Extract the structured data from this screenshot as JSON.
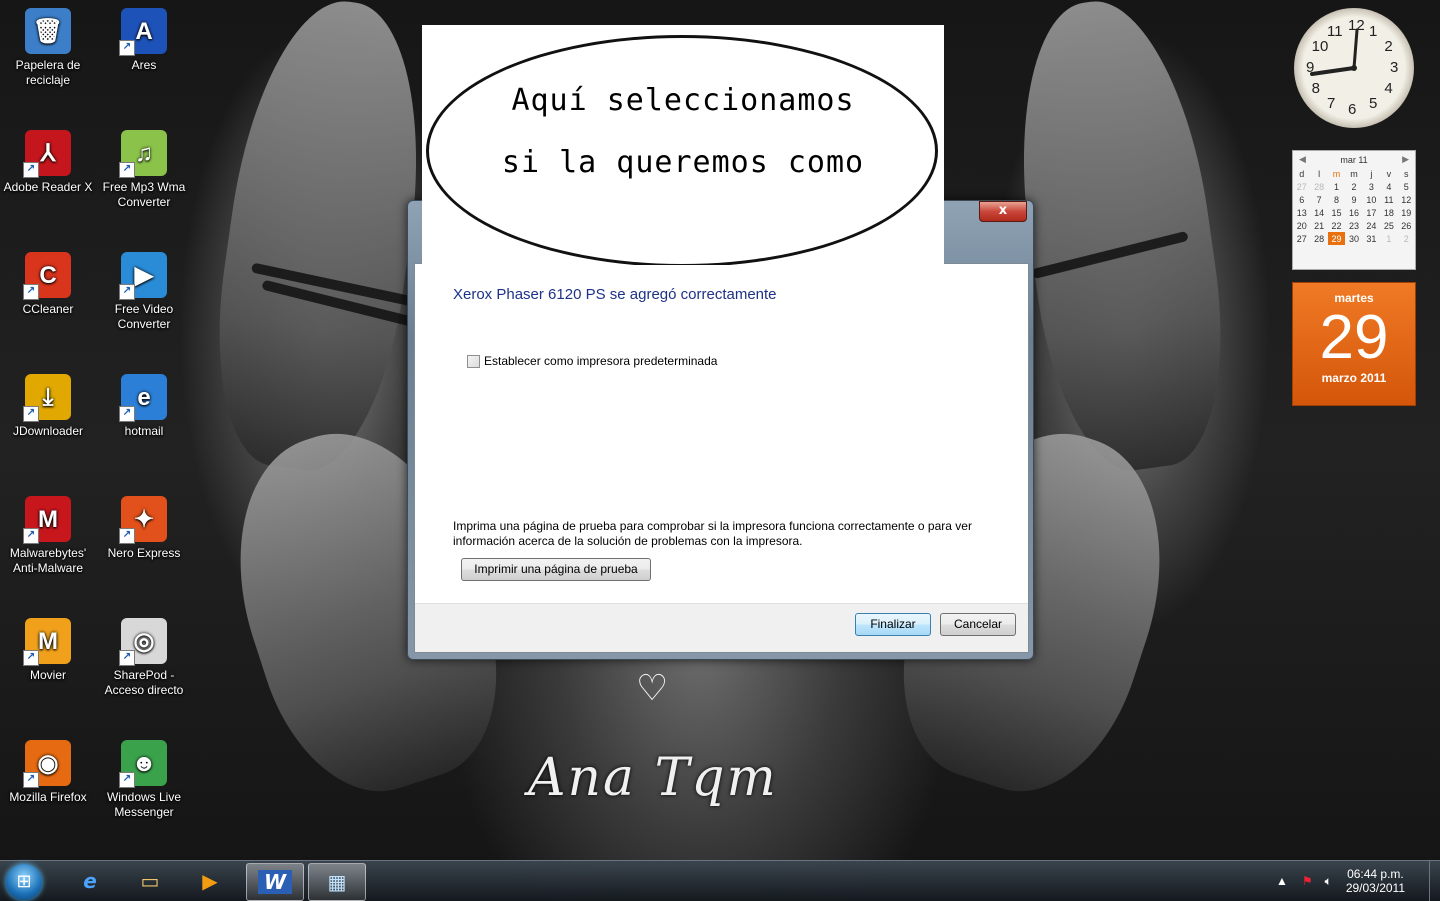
{
  "desktop_icons": [
    {
      "label": "Papelera de reciclaje",
      "icon": "recycle-bin-icon",
      "color": "#3c7ec7"
    },
    {
      "label": "Ares",
      "icon": "ares-icon",
      "color": "#1d52b8"
    },
    {
      "label": "Adobe Reader X",
      "icon": "adobe-reader-icon",
      "color": "#c4161c"
    },
    {
      "label": "Free Mp3 Wma Converter",
      "icon": "mp3-converter-icon",
      "color": "#8bc34a"
    },
    {
      "label": "CCleaner",
      "icon": "ccleaner-icon",
      "color": "#d9341c"
    },
    {
      "label": "Free Video Converter",
      "icon": "video-converter-icon",
      "color": "#2a8bd6"
    },
    {
      "label": "JDownloader",
      "icon": "jdownloader-icon",
      "color": "#e0a800"
    },
    {
      "label": "hotmail",
      "icon": "internet-explorer-icon",
      "color": "#2b7fd6"
    },
    {
      "label": "Malwarebytes' Anti-Malware",
      "icon": "malwarebytes-icon",
      "color": "#c8161d"
    },
    {
      "label": "Nero Express",
      "icon": "nero-icon",
      "color": "#e2501b"
    },
    {
      "label": "Movier",
      "icon": "movier-icon",
      "color": "#f0a01a"
    },
    {
      "label": "SharePod - Acceso directo",
      "icon": "ipod-icon",
      "color": "#d8d8d8"
    },
    {
      "label": "Mozilla Firefox",
      "icon": "firefox-icon",
      "color": "#e66a12"
    },
    {
      "label": "Windows Live Messenger",
      "icon": "messenger-icon",
      "color": "#3aa24a"
    }
  ],
  "callout": {
    "line1": "Aquí seleccionamos",
    "line2": "si la queremos como"
  },
  "dialog": {
    "close_label": "x",
    "heading": "Xerox Phaser 6120 PS se agregó correctamente",
    "default_checkbox_label": "Establecer como impresora predeterminada",
    "default_checked": false,
    "info_text": "Imprima una página de prueba para comprobar si la impresora funciona correctamente o para ver información acerca de la solución de problemas con la impresora.",
    "test_page_button": "Imprimir una página de prueba",
    "finish_button": "Finalizar",
    "cancel_button": "Cancelar"
  },
  "gadgets": {
    "clock_numbers": [
      "12",
      "1",
      "2",
      "3",
      "4",
      "5",
      "6",
      "7",
      "8",
      "9",
      "10",
      "11"
    ],
    "calendar_small": {
      "month_label": "mar 11",
      "weekdays": [
        "d",
        "l",
        "m",
        "m",
        "j",
        "v",
        "s"
      ],
      "weeks": [
        [
          "27",
          "28",
          "1",
          "2",
          "3",
          "4",
          "5"
        ],
        [
          "6",
          "7",
          "8",
          "9",
          "10",
          "11",
          "12"
        ],
        [
          "13",
          "14",
          "15",
          "16",
          "17",
          "18",
          "19"
        ],
        [
          "20",
          "21",
          "22",
          "23",
          "24",
          "25",
          "26"
        ],
        [
          "27",
          "28",
          "29",
          "30",
          "31",
          "1",
          "2"
        ]
      ],
      "today": "29"
    },
    "calendar_big": {
      "weekday": "martes",
      "day": "29",
      "month_year": "marzo 2011"
    }
  },
  "wallpaper_text": {
    "signature": "Ana Tqm"
  },
  "taskbar": {
    "time": "06:44 p.m.",
    "date": "29/03/2011",
    "pinned": [
      "internet-explorer-icon",
      "explorer-folder-icon",
      "media-player-icon",
      "word-icon",
      "devices-printers-icon"
    ]
  }
}
